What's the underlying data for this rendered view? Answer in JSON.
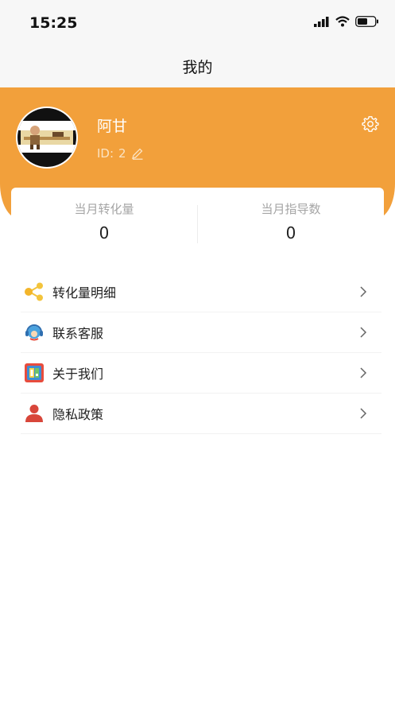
{
  "status_bar": {
    "time": "15:25",
    "icons": [
      "signal-icon",
      "wifi-icon",
      "battery-icon"
    ]
  },
  "nav": {
    "title": "我的"
  },
  "profile": {
    "name": "阿甘",
    "id_label": "ID: ",
    "id_value": "2",
    "edit_icon": "pencil-icon",
    "settings_icon": "gear-icon",
    "avatar_icon": "avatar-image"
  },
  "stats": [
    {
      "label": "当月转化量",
      "value": "0"
    },
    {
      "label": "当月指导数",
      "value": "0"
    }
  ],
  "menu": [
    {
      "label": "转化量明细",
      "icon": "share-nodes-icon"
    },
    {
      "label": "联系客服",
      "icon": "customer-service-icon"
    },
    {
      "label": "关于我们",
      "icon": "about-us-icon"
    },
    {
      "label": "隐私政策",
      "icon": "person-icon"
    }
  ],
  "colors": {
    "accent": "#f2a03b",
    "background": "#ffffff",
    "nav_background": "#f7f7f7"
  }
}
